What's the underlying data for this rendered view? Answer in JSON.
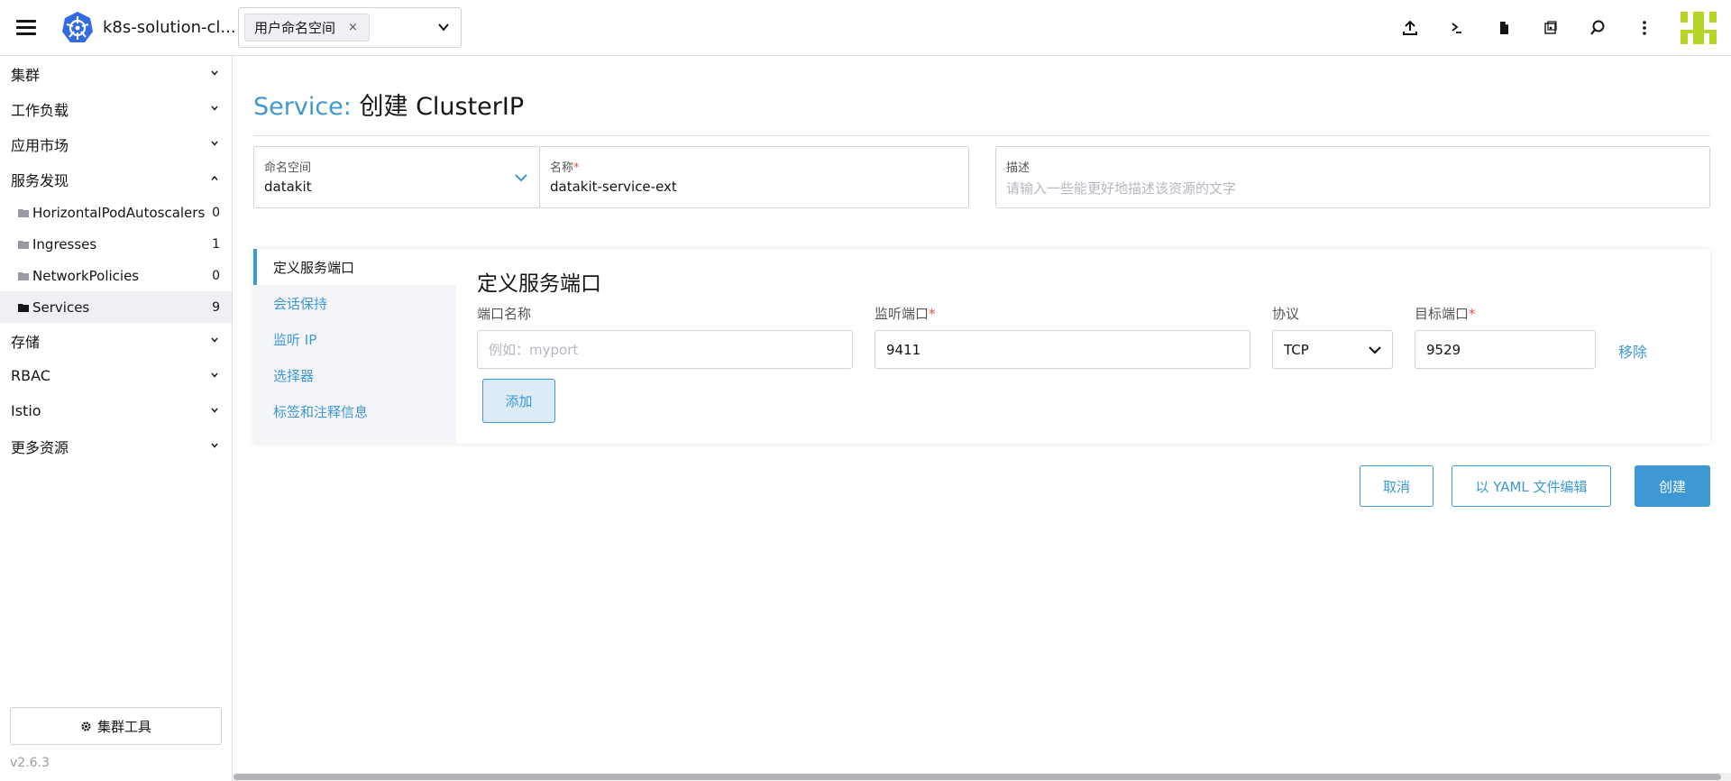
{
  "header": {
    "cluster_name": "k8s-solution-cl...",
    "namespace_chip": "用户命名空间",
    "chip_close": "×",
    "icons": [
      "import-yaml-icon",
      "kubectl-shell-icon",
      "kubeconfig-icon",
      "copy-kubeconfig-icon",
      "search-icon",
      "more-icon"
    ]
  },
  "sidebar": {
    "groups": [
      {
        "label": "集群"
      },
      {
        "label": "工作负载"
      },
      {
        "label": "应用市场"
      },
      {
        "label": "服务发现"
      },
      {
        "label": "存储"
      },
      {
        "label": "RBAC"
      },
      {
        "label": "Istio"
      },
      {
        "label": "更多资源"
      }
    ],
    "service_discovery_items": [
      {
        "label": "HorizontalPodAutoscalers",
        "count": "0"
      },
      {
        "label": "Ingresses",
        "count": "1"
      },
      {
        "label": "NetworkPolicies",
        "count": "0"
      },
      {
        "label": "Services",
        "count": "9"
      }
    ],
    "cluster_tools": "集群工具",
    "version": "v2.6.3"
  },
  "page": {
    "title_resource": "Service:",
    "title_action": "创建 ClusterIP"
  },
  "form": {
    "namespace_label": "命名空间",
    "namespace_value": "datakit",
    "name_label": "名称",
    "name_value": "datakit-service-ext",
    "description_label": "描述",
    "description_placeholder": "请输入一些能更好地描述该资源的文字",
    "required_mark": "*"
  },
  "tabs": [
    {
      "label": "定义服务端口"
    },
    {
      "label": "会话保持"
    },
    {
      "label": "监听 IP"
    },
    {
      "label": "选择器"
    },
    {
      "label": "标签和注释信息"
    }
  ],
  "ports": {
    "section_title": "定义服务端口",
    "port_name_label": "端口名称",
    "port_name_placeholder": "例如：myport",
    "listen_port_label": "监听端口",
    "listen_port_value": "9411",
    "protocol_label": "协议",
    "protocol_value": "TCP",
    "target_port_label": "目标端口",
    "target_port_value": "9529",
    "remove_label": "移除",
    "add_label": "添加"
  },
  "actions": {
    "cancel": "取消",
    "edit_yaml": "以 YAML 文件编辑",
    "create": "创建"
  },
  "colors": {
    "accent": "#3d98d3",
    "required": "#d9534f",
    "avatar": "#b6d627"
  }
}
